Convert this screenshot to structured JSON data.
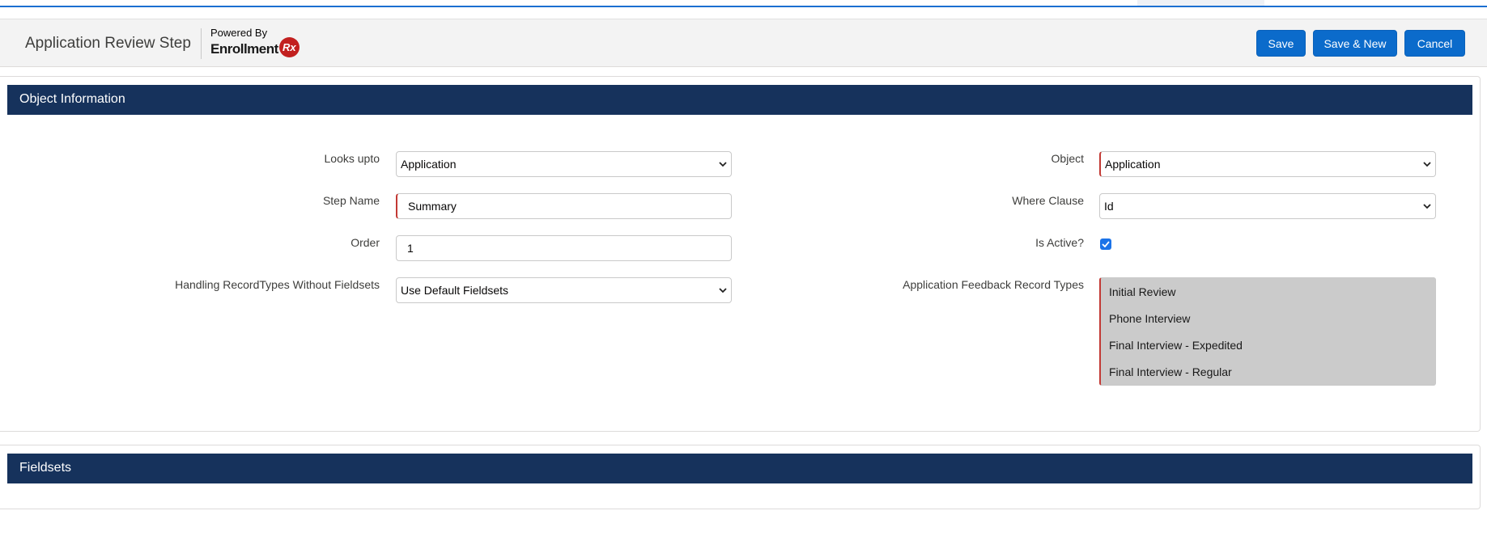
{
  "header": {
    "title": "Application Review Step",
    "powered_by": "Powered By",
    "logo_text": "Enrollment",
    "logo_badge": "Rx",
    "buttons": {
      "save": "Save",
      "save_new": "Save & New",
      "cancel": "Cancel"
    }
  },
  "sections": {
    "object_information": "Object Information",
    "fieldsets": "Fieldsets"
  },
  "form": {
    "looks_upto": {
      "label": "Looks upto",
      "value": "Application"
    },
    "step_name": {
      "label": "Step Name",
      "value": "Summary"
    },
    "order": {
      "label": "Order",
      "value": "1"
    },
    "handling": {
      "label": "Handling RecordTypes Without Fieldsets",
      "value": "Use Default Fieldsets"
    },
    "object": {
      "label": "Object",
      "value": "Application"
    },
    "where_clause": {
      "label": "Where Clause",
      "value": "Id"
    },
    "is_active": {
      "label": "Is Active?",
      "checked": true
    },
    "feedback_types": {
      "label": "Application Feedback Record Types",
      "options": [
        "Initial Review",
        "Phone Interview",
        "Final Interview - Expedited",
        "Final Interview - Regular"
      ]
    }
  },
  "colors": {
    "brand_blue": "#0b6bcb",
    "section_navy": "#16325c",
    "required_red": "#c23934",
    "logo_red": "#c2201f"
  }
}
